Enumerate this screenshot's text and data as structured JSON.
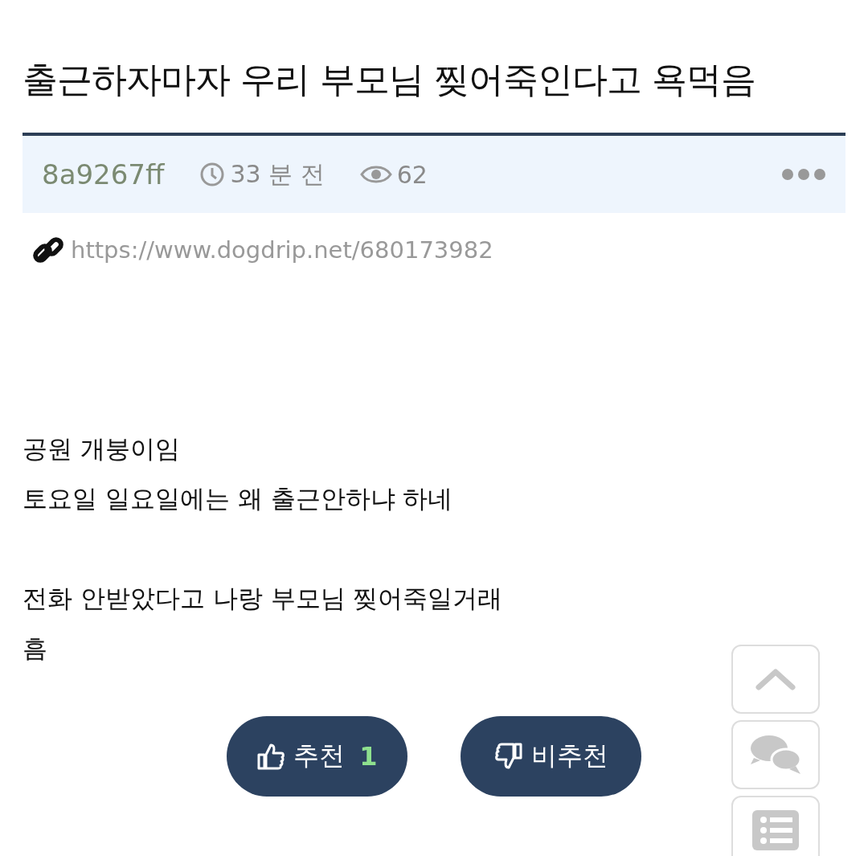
{
  "title": "출근하자마자 우리 부모님 찢어죽인다고 욕먹음",
  "meta": {
    "author": "8a9267ff",
    "time": "33 분 전",
    "views": "62"
  },
  "link": "https://www.dogdrip.net/680173982",
  "body": [
    {
      "lines": [
        "공원 개붕이임",
        "토요일 일요일에는 왜 출근안하냐 하네"
      ]
    },
    {
      "lines": [
        "전화 안받았다고 나랑 부모님 찢어죽일거래",
        "흠"
      ]
    }
  ],
  "votes": [
    {
      "kind": "up",
      "label": "추천",
      "count": "1"
    },
    {
      "kind": "down",
      "label": "비추천"
    }
  ],
  "floating": [
    {
      "kind": "top"
    },
    {
      "kind": "comments"
    },
    {
      "kind": "list"
    }
  ]
}
